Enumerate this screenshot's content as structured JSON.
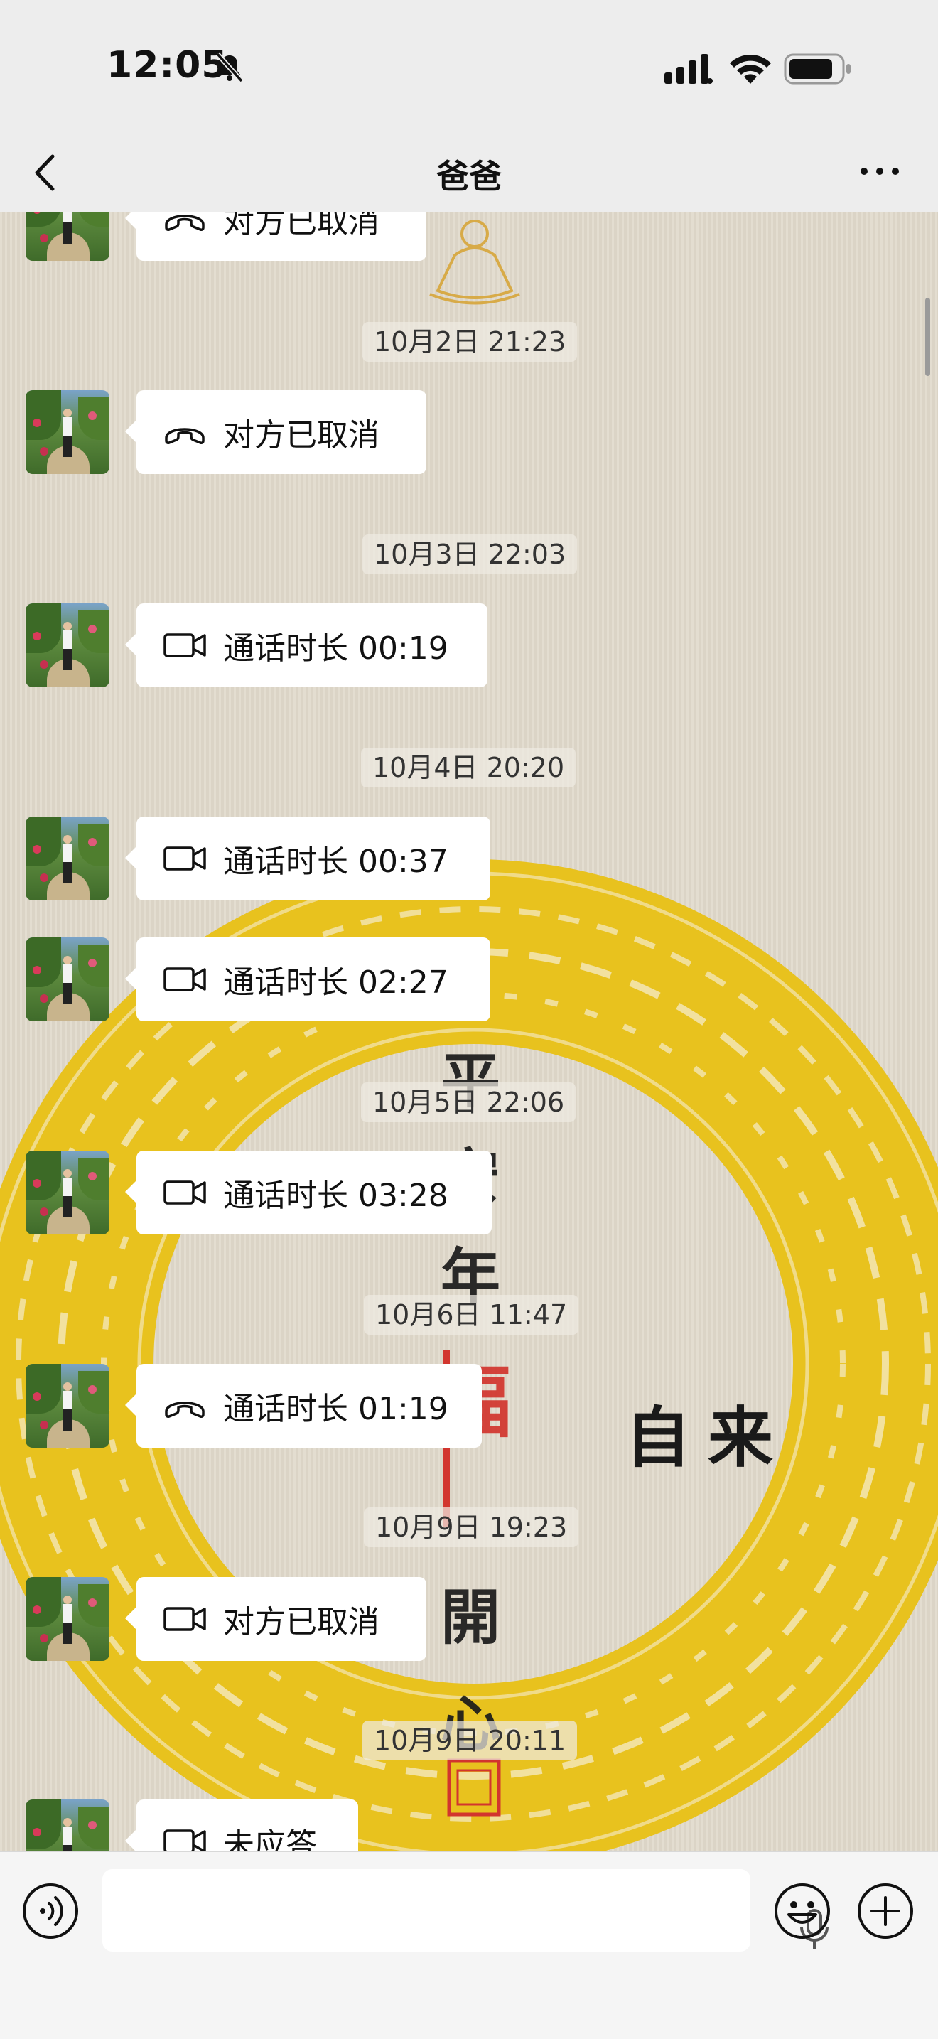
{
  "status_bar": {
    "time": "12:05",
    "icons": [
      "bell-muted-icon",
      "cellular-signal-icon",
      "wifi-icon",
      "battery-icon"
    ]
  },
  "nav": {
    "title": "爸爸",
    "back_icon": "chevron-left-icon",
    "more_icon": "more-dots-icon"
  },
  "messages": [
    {
      "kind": "call",
      "icon": "voice-call-icon",
      "text": "对方已取消"
    },
    {
      "kind": "timestamp",
      "text": "10月2日 21:23"
    },
    {
      "kind": "call",
      "icon": "voice-call-icon",
      "text": "对方已取消"
    },
    {
      "kind": "timestamp",
      "text": "10月3日 22:03"
    },
    {
      "kind": "call",
      "icon": "video-call-icon",
      "text": "通话时长 00:19"
    },
    {
      "kind": "timestamp",
      "text": "10月4日 20:20"
    },
    {
      "kind": "call",
      "icon": "video-call-icon",
      "text": "通话时长 00:37"
    },
    {
      "kind": "call",
      "icon": "video-call-icon",
      "text": "通话时长 02:27"
    },
    {
      "kind": "timestamp",
      "text": "10月5日 22:06"
    },
    {
      "kind": "call",
      "icon": "video-call-icon",
      "text": "通话时长 03:28"
    },
    {
      "kind": "timestamp",
      "text": "10月6日 11:47"
    },
    {
      "kind": "call",
      "icon": "voice-call-icon",
      "text": "通话时长 01:19"
    },
    {
      "kind": "timestamp",
      "text": "10月9日 19:23"
    },
    {
      "kind": "call",
      "icon": "video-call-icon",
      "text": "对方已取消"
    },
    {
      "kind": "timestamp",
      "text": "10月9日 20:11"
    },
    {
      "kind": "call",
      "icon": "video-call-icon",
      "text": "未应答"
    }
  ],
  "wallpaper": {
    "vertical_text": [
      "平",
      "安",
      "年",
      "福",
      "開",
      "心"
    ],
    "side_text": "自来",
    "ring_color": "#e8c21e",
    "seal_color": "#d2352e"
  },
  "input_bar": {
    "icons": [
      "voice-input-icon",
      "microphone-icon",
      "emoji-icon",
      "plus-icon"
    ]
  }
}
